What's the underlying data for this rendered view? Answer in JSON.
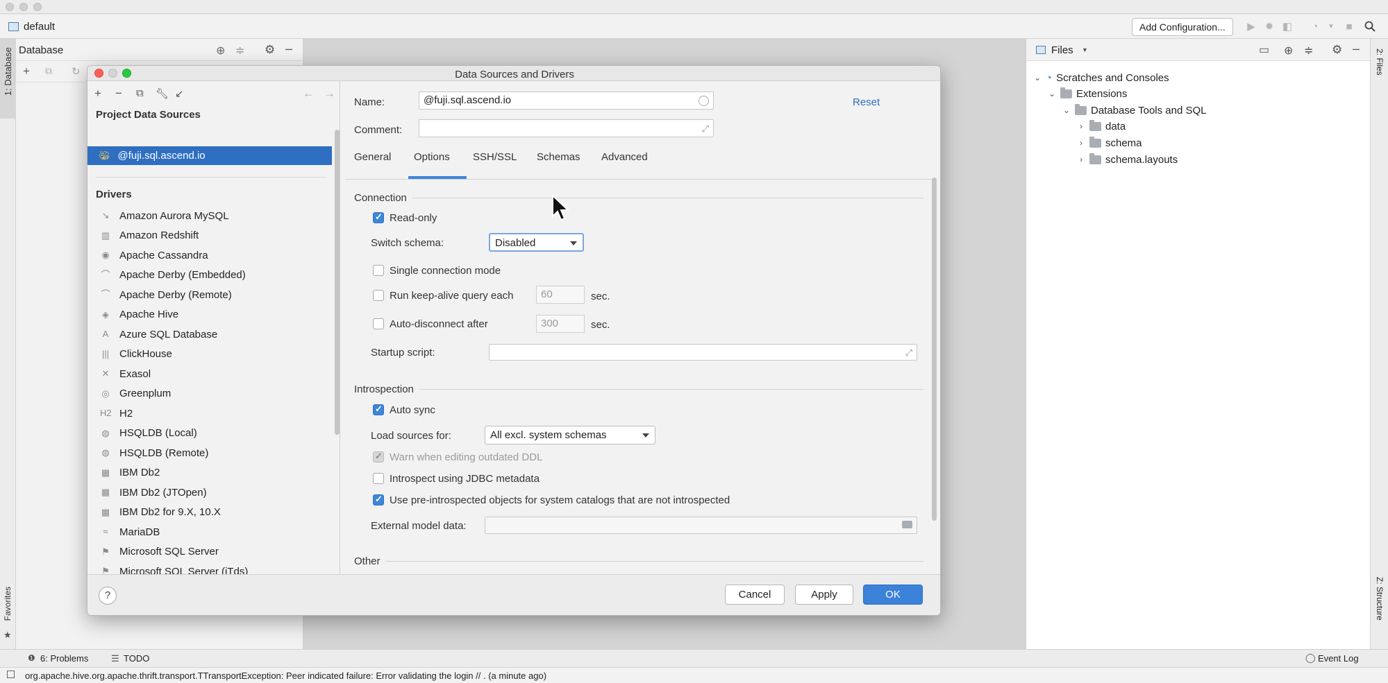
{
  "toolbar": {
    "project_name": "default",
    "add_configuration": "Add Configuration..."
  },
  "left_strip": {
    "database_tab": "1: Database",
    "favorites_tab": "Favorites"
  },
  "database_panel": {
    "title": "Database"
  },
  "files_panel": {
    "title": "Files",
    "tree": [
      {
        "label": "Scratches and Consoles",
        "expanded": true,
        "level": 0
      },
      {
        "label": "Extensions",
        "expanded": true,
        "level": 1
      },
      {
        "label": "Database Tools and SQL",
        "expanded": true,
        "level": 2
      },
      {
        "label": "data",
        "expanded": false,
        "level": 3
      },
      {
        "label": "schema",
        "expanded": false,
        "level": 3
      },
      {
        "label": "schema.layouts",
        "expanded": false,
        "level": 3
      }
    ]
  },
  "right_strip": {
    "files_tab": "2: Files",
    "structure_tab": "Z: Structure"
  },
  "bottom_tabs": {
    "problems": "6: Problems",
    "todo": "TODO",
    "event_log": "Event Log"
  },
  "status_bar": {
    "message": "org.apache.hive.org.apache.thrift.transport.TTransportException: Peer indicated failure: Error validating the login // . (a minute ago)"
  },
  "dialog": {
    "title": "Data Sources and Drivers",
    "project_sources_heading": "Project Data Sources",
    "selected_source": "@fuji.sql.ascend.io",
    "drivers_heading": "Drivers",
    "drivers": [
      {
        "label": "Amazon Aurora MySQL",
        "icon": "aurora-icon"
      },
      {
        "label": "Amazon Redshift",
        "icon": "redshift-icon"
      },
      {
        "label": "Apache Cassandra",
        "icon": "cassandra-icon"
      },
      {
        "label": "Apache Derby (Embedded)",
        "icon": "derby-icon"
      },
      {
        "label": "Apache Derby (Remote)",
        "icon": "derby-icon"
      },
      {
        "label": "Apache Hive",
        "icon": "hive-icon"
      },
      {
        "label": "Azure SQL Database",
        "icon": "azure-icon"
      },
      {
        "label": "ClickHouse",
        "icon": "clickhouse-icon"
      },
      {
        "label": "Exasol",
        "icon": "exasol-icon"
      },
      {
        "label": "Greenplum",
        "icon": "greenplum-icon"
      },
      {
        "label": "H2",
        "icon": "h2-icon"
      },
      {
        "label": "HSQLDB (Local)",
        "icon": "hsqldb-icon"
      },
      {
        "label": "HSQLDB (Remote)",
        "icon": "hsqldb-icon"
      },
      {
        "label": "IBM Db2",
        "icon": "db2-icon"
      },
      {
        "label": "IBM Db2 (JTOpen)",
        "icon": "db2-icon"
      },
      {
        "label": "IBM Db2 for 9.X, 10.X",
        "icon": "db2-icon"
      },
      {
        "label": "MariaDB",
        "icon": "mariadb-icon"
      },
      {
        "label": "Microsoft SQL Server",
        "icon": "mssql-icon"
      },
      {
        "label": "Microsoft SQL Server (jTds)",
        "icon": "mssql-icon"
      }
    ],
    "name_label": "Name:",
    "name_value": "@fuji.sql.ascend.io",
    "comment_label": "Comment:",
    "comment_value": "",
    "reset": "Reset",
    "tabs": [
      "General",
      "Options",
      "SSH/SSL",
      "Schemas",
      "Advanced"
    ],
    "active_tab": "Options",
    "connection": {
      "heading": "Connection",
      "read_only": {
        "label": "Read-only",
        "checked": true
      },
      "switch_schema_label": "Switch schema:",
      "switch_schema_value": "Disabled",
      "single_connection": {
        "label": "Single connection mode",
        "checked": false
      },
      "keep_alive": {
        "label": "Run keep-alive query each",
        "checked": false,
        "value": "60",
        "unit": "sec."
      },
      "auto_disconnect": {
        "label": "Auto-disconnect after",
        "checked": false,
        "value": "300",
        "unit": "sec."
      },
      "startup_script_label": "Startup script:",
      "startup_script_value": ""
    },
    "introspection": {
      "heading": "Introspection",
      "auto_sync": {
        "label": "Auto sync",
        "checked": true
      },
      "load_sources_label": "Load sources for:",
      "load_sources_value": "All excl. system schemas",
      "warn_outdated": {
        "label": "Warn when editing outdated DDL",
        "checked": true,
        "disabled": true
      },
      "jdbc_metadata": {
        "label": "Introspect using JDBC metadata",
        "checked": false
      },
      "pre_introspected": {
        "label": "Use pre-introspected objects for system catalogs that are not introspected",
        "checked": true
      },
      "external_model_label": "External model data:",
      "external_model_value": ""
    },
    "other_heading": "Other",
    "buttons": {
      "help": "?",
      "cancel": "Cancel",
      "apply": "Apply",
      "ok": "OK"
    }
  }
}
